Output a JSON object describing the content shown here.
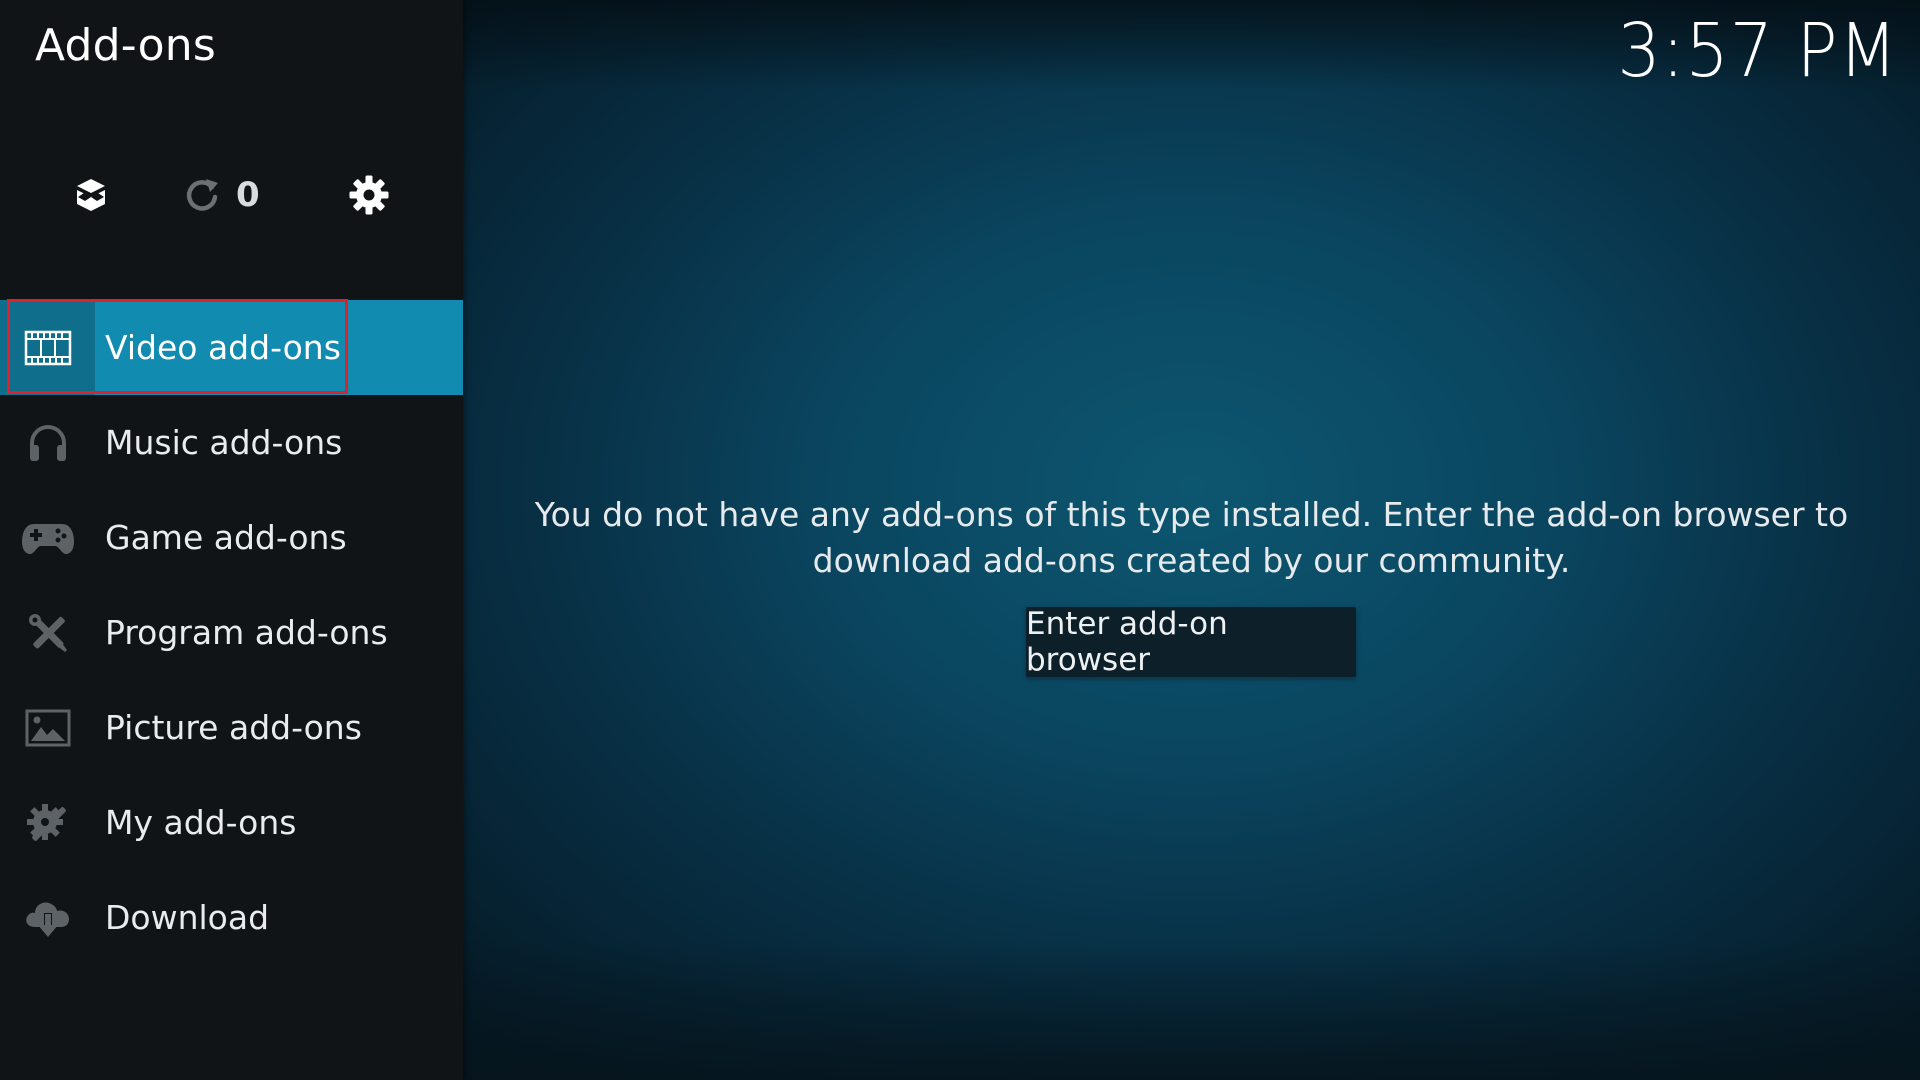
{
  "window": {
    "title": "Add-ons",
    "clock": "3:57 PM"
  },
  "toolbar": {
    "install_icon": "box-open-icon",
    "update_icon": "refresh-icon",
    "update_count": "0",
    "settings_icon": "gear-icon"
  },
  "sidebar": {
    "items": [
      {
        "label": "Video add-ons",
        "icon": "film-icon",
        "active": true
      },
      {
        "label": "Music add-ons",
        "icon": "headphones-icon",
        "active": false
      },
      {
        "label": "Game add-ons",
        "icon": "gamepad-icon",
        "active": false
      },
      {
        "label": "Program add-ons",
        "icon": "tools-icon",
        "active": false
      },
      {
        "label": "Picture add-ons",
        "icon": "picture-icon",
        "active": false
      },
      {
        "label": "My add-ons",
        "icon": "gear-wrench-icon",
        "active": false
      },
      {
        "label": "Download",
        "icon": "cloud-download-icon",
        "active": false
      }
    ]
  },
  "main": {
    "empty_message": "You do not have any add-ons of this type installed. Enter the add-on browser to download add-ons created by our community.",
    "browser_button_label": "Enter add-on browser"
  },
  "colors": {
    "active_item": "#128bb0",
    "active_icon_box": "#0e6e8b",
    "focus_outline": "#e0202a",
    "sidebar_bg": "#111416",
    "main_bg": "#0a4660"
  }
}
